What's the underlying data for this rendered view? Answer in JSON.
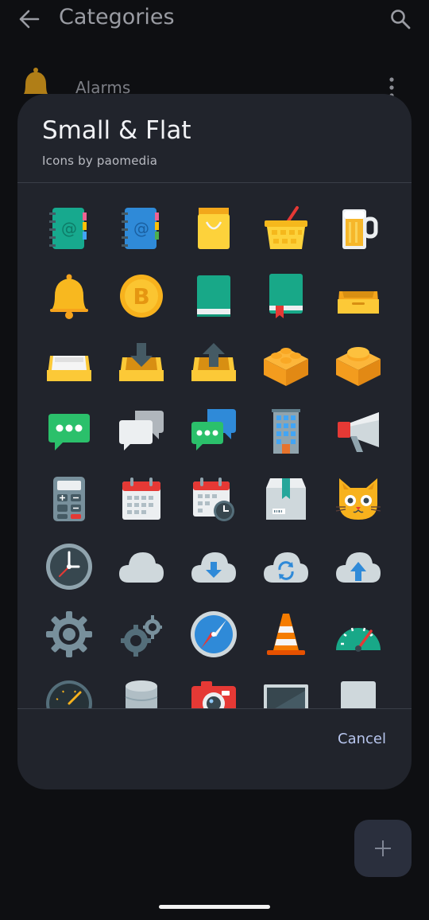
{
  "appbar": {
    "title": "Categories",
    "back_icon": "arrow-left-icon",
    "search_icon": "search-icon"
  },
  "background_list": {
    "item_label": "Alarms"
  },
  "dialog": {
    "title": "Small & Flat",
    "subtitle": "Icons by paomedia",
    "cancel_label": "Cancel",
    "icons": [
      "address-book-green-icon",
      "address-book-blue-icon",
      "shopping-bag-icon",
      "shopping-basket-icon",
      "beer-mug-icon",
      "bell-icon",
      "bitcoin-icon",
      "book-green-icon",
      "book-bookmark-icon",
      "drawer-open-icon",
      "inbox-tray-icon",
      "tray-download-icon",
      "tray-upload-icon",
      "lego-brick-4-icon",
      "lego-brick-1-icon",
      "chat-bubble-green-icon",
      "chat-bubbles-gray-icon",
      "chat-bubbles-blue-green-icon",
      "office-building-icon",
      "megaphone-icon",
      "calculator-icon",
      "calendar-icon",
      "calendar-clock-icon",
      "package-box-icon",
      "cat-face-icon",
      "clock-icon",
      "cloud-icon",
      "cloud-download-icon",
      "cloud-sync-icon",
      "cloud-upload-icon",
      "gear-icon",
      "gears-icon",
      "compass-icon",
      "traffic-cone-icon",
      "speedometer-icon",
      "gauge-dark-icon",
      "database-icon",
      "camera-icon",
      "monitor-icon",
      "blank-tile-icon"
    ]
  },
  "fab": {
    "icon": "plus-icon"
  }
}
